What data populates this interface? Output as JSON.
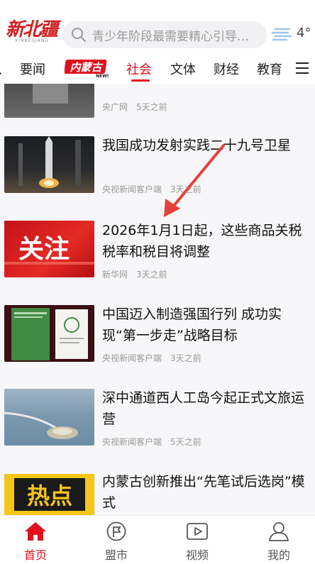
{
  "header": {
    "logo_text": "新北疆",
    "logo_sub": "XINBEIJIANG",
    "search_placeholder": "青少年阶段最需要精心引导…",
    "temperature": "4°",
    "weather_icon": "fog-icon"
  },
  "nav": {
    "items": [
      "要闻",
      "社会",
      "文体",
      "财经",
      "教育"
    ],
    "badge_label": "内蒙古",
    "active": "社会"
  },
  "feed": [
    {
      "title": "",
      "source": "央广网",
      "time": "5天之前"
    },
    {
      "title": "我国成功发射实践二十九号卫星",
      "source": "央视新闻客户端",
      "time": "3天之前"
    },
    {
      "title": "2026年1月1日起，这些商品关税税率和税目将调整",
      "source": "新华网",
      "time": "3天之前",
      "thumb_text": "关注"
    },
    {
      "title": "中国迈入制造强国行列 成功实现“第一步走”战略目标",
      "source": "央视新闻客户端",
      "time": "3天之前"
    },
    {
      "title": "深中通道西人工岛今起正式文旅运营",
      "source": "央视新闻客户端",
      "time": "5天之前"
    },
    {
      "title": "内蒙古创新推出“先笔试后选岗”模式",
      "source": "",
      "time": "",
      "thumb_text": "热点"
    }
  ],
  "tabbar": {
    "items": [
      "首页",
      "盟市",
      "视频",
      "我的"
    ],
    "active": "首页"
  },
  "colors": {
    "accent": "#e0101f",
    "meta": "#999999",
    "background": "#f7f7f9"
  }
}
